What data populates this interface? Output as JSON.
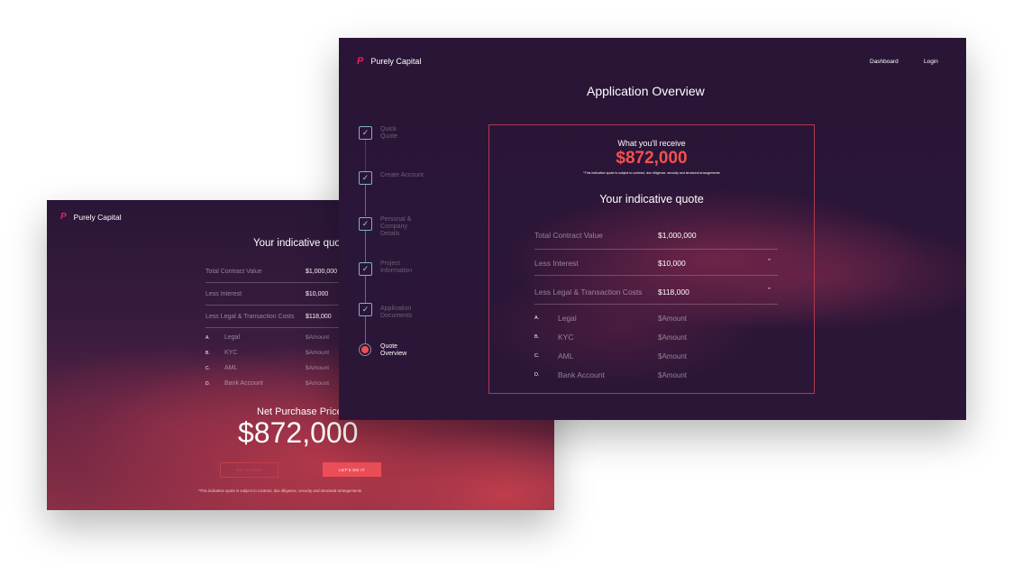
{
  "brand": {
    "name": "Purely Capital",
    "logo_glyph": "P",
    "accent": "#e0245e",
    "highlight": "#f2514f"
  },
  "back_window": {
    "title": "Your indicative quote",
    "rows": [
      {
        "label": "Total Contract Value",
        "value": "$1,000,000"
      },
      {
        "label": "Less Interest",
        "value": "$10,000"
      },
      {
        "label": "Less Legal & Transaction Costs",
        "value": "$118,000"
      }
    ],
    "breakdown": [
      {
        "letter": "A.",
        "label": "Legal",
        "value": "$Amount"
      },
      {
        "letter": "B.",
        "label": "KYC",
        "value": "$Amount"
      },
      {
        "letter": "C.",
        "label": "AML",
        "value": "$Amount"
      },
      {
        "letter": "D.",
        "label": "Bank Account",
        "value": "$Amount"
      }
    ],
    "net_label": "Net Purchase Price",
    "net_value": "$872,000",
    "no_thanks": "NO THANKS",
    "lets_do_it": "LET'S DO IT",
    "disclaimer": "*This indicative quote is subject to contract, due diligence, security and structural arrangements"
  },
  "front_window": {
    "nav": {
      "dashboard": "Dashboard",
      "login": "Login"
    },
    "page_title": "Application Overview",
    "steps": [
      {
        "label": "Quick Quote",
        "lines": [
          "Quick",
          "Quote"
        ],
        "done": true
      },
      {
        "label": "Create Account",
        "lines": [
          "Create Account"
        ],
        "done": true
      },
      {
        "label": "Personal & Company Details",
        "lines": [
          "Personal &",
          "Company",
          "Details"
        ],
        "done": true
      },
      {
        "label": "Project Information",
        "lines": [
          "Project",
          "Information"
        ],
        "done": true
      },
      {
        "label": "Application Documents",
        "lines": [
          "Application",
          "Documents"
        ],
        "done": true
      },
      {
        "label": "Quote Overview",
        "lines": [
          "Quote",
          "Overview"
        ],
        "done": false,
        "active": true
      }
    ],
    "receive_label": "What you'll receive",
    "receive_value": "$872,000",
    "disclaimer": "*This indicative quote is subject to contract, due diligence, security and structural arrangements",
    "quote_title": "Your indicative quote",
    "rows": [
      {
        "label": "Total Contract Value",
        "value": "$1,000,000",
        "toggle": ""
      },
      {
        "label": "Less Interest",
        "value": "$10,000",
        "toggle": "ˇ"
      },
      {
        "label": "Less Legal & Transaction Costs",
        "value": "$118,000",
        "toggle": "ˆ"
      }
    ],
    "breakdown": [
      {
        "letter": "A.",
        "label": "Legal",
        "value": "$Amount"
      },
      {
        "letter": "B.",
        "label": "KYC",
        "value": "$Amount"
      },
      {
        "letter": "C.",
        "label": "AML",
        "value": "$Amount"
      },
      {
        "letter": "D.",
        "label": "Bank Account",
        "value": "$Amount"
      }
    ]
  }
}
